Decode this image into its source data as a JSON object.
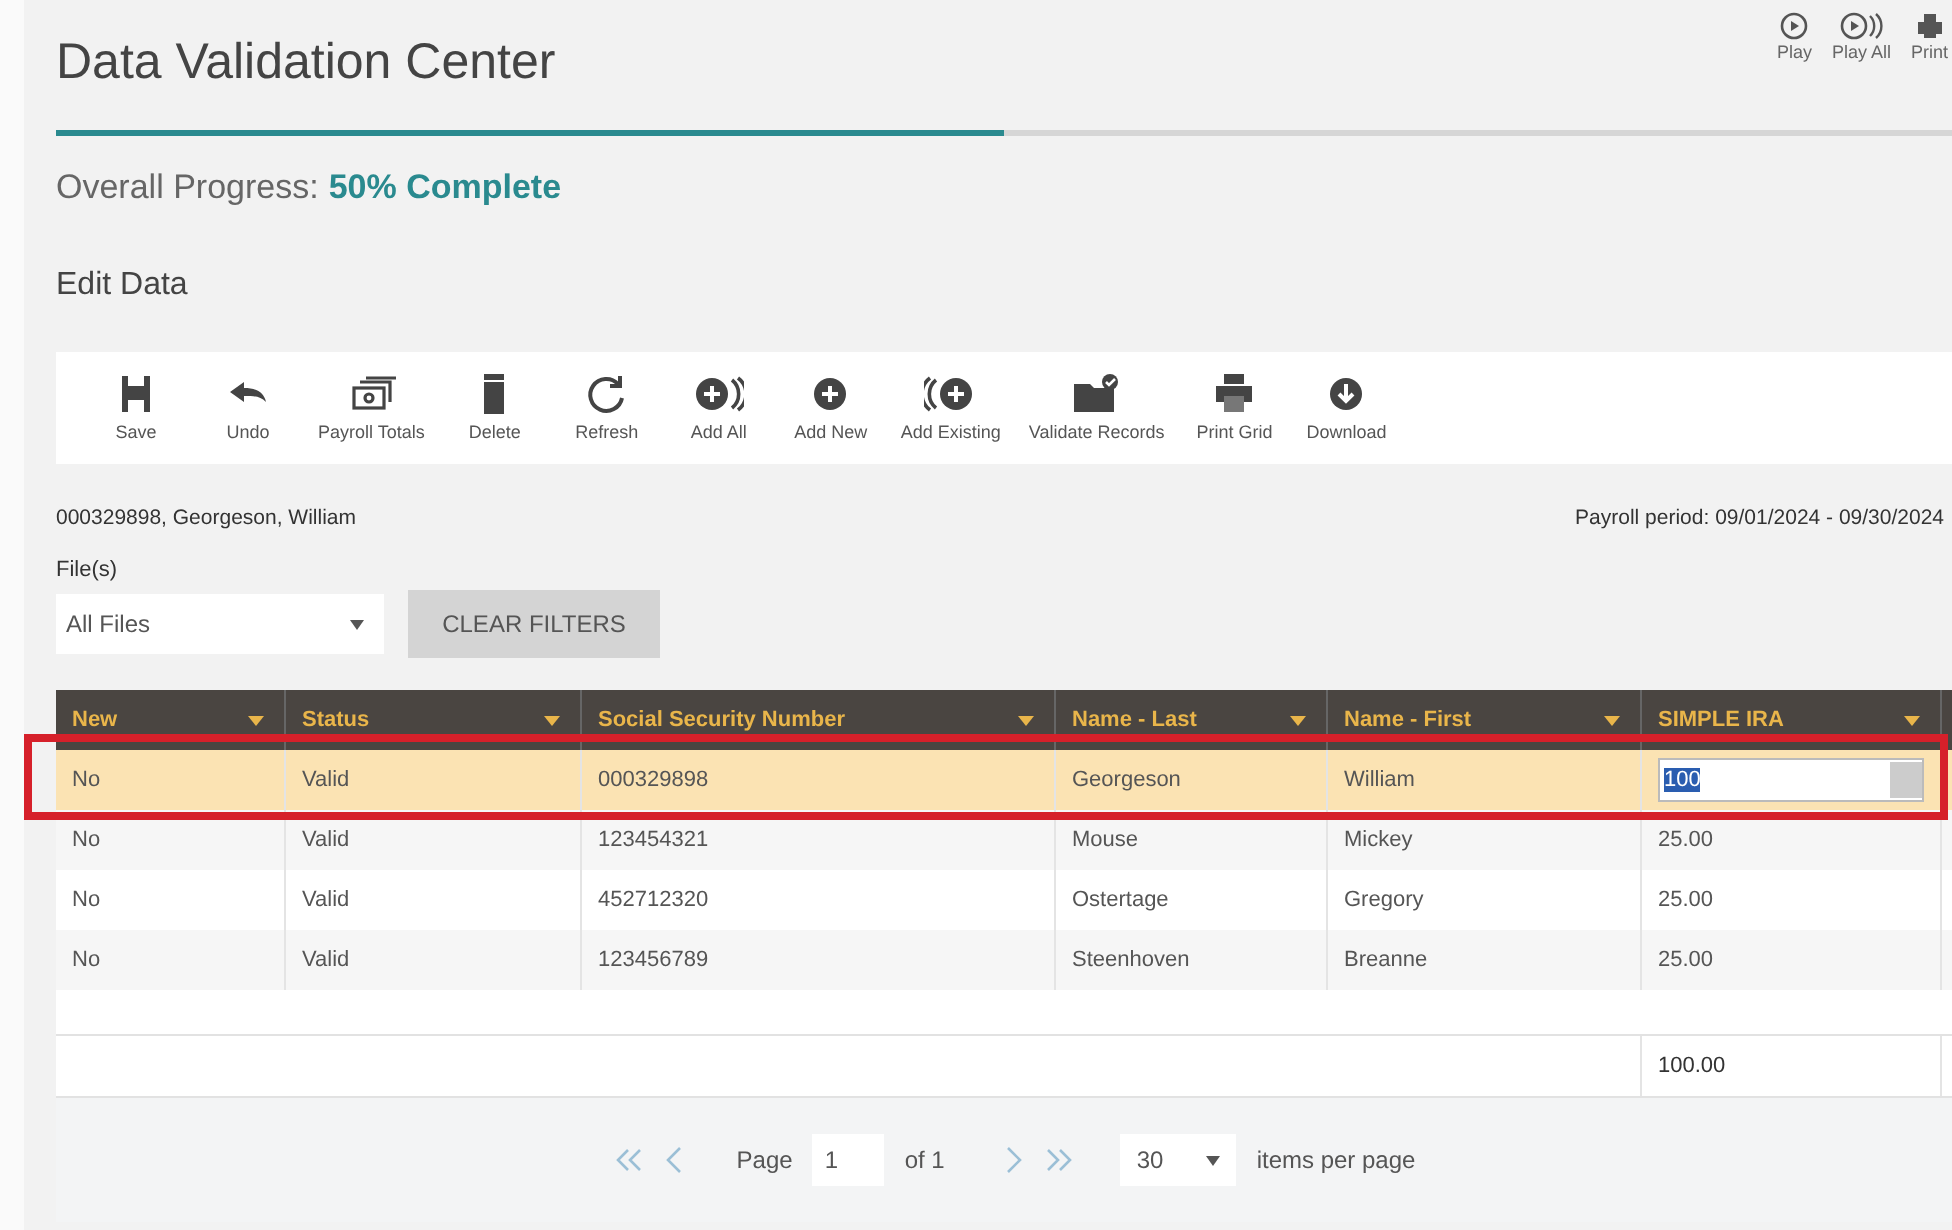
{
  "title": "Data Validation Center",
  "header_actions": [
    {
      "kind": "play",
      "label": "Play"
    },
    {
      "kind": "play-all",
      "label": "Play All"
    },
    {
      "kind": "print",
      "label": "Print"
    }
  ],
  "progress": {
    "level": 0.5,
    "label": "Overall Progress:",
    "value": "50% Complete"
  },
  "section_title": "Edit Data",
  "toolbar": [
    {
      "label": "Save"
    },
    {
      "label": "Undo"
    },
    {
      "label": "Payroll Totals"
    },
    {
      "label": "Delete"
    },
    {
      "label": "Refresh"
    },
    {
      "label": "Add All"
    },
    {
      "label": "Add New"
    },
    {
      "label": "Add Existing"
    },
    {
      "label": "Validate Records"
    },
    {
      "label": "Print Grid"
    },
    {
      "label": "Download"
    }
  ],
  "employee": "000329898, Georgeson, William",
  "payroll_period": "Payroll period: 09/01/2024 - 09/30/2024",
  "files": {
    "label": "File(s)",
    "value": "All Files"
  },
  "clear_button": "CLEAR FILTERS",
  "table": {
    "columns": [
      "New",
      "Status",
      "Social Security Number",
      "Name - Last",
      "Name - First",
      "SIMPLE IRA"
    ],
    "rows": [
      {
        "cells": [
          "No",
          "Valid",
          "000329898",
          "Georgeson",
          "William",
          "100"
        ],
        "selected": true
      },
      {
        "cells": [
          "No",
          "Valid",
          "123454321",
          "Mouse",
          "Mickey",
          "25.00"
        ],
        "selected": false
      },
      {
        "cells": [
          "No",
          "Valid",
          "452712320",
          "Ostertage",
          "Gregory",
          "25.00"
        ],
        "selected": false
      },
      {
        "cells": [
          "No",
          "Valid",
          "123456789",
          "Steenhoven",
          "Breanne",
          "25.00"
        ],
        "selected": false
      }
    ],
    "total": "100.00"
  },
  "pager": {
    "page_label": "Page",
    "page": "1",
    "of": "of 1",
    "page_size": "30",
    "per_page": "items per page"
  }
}
